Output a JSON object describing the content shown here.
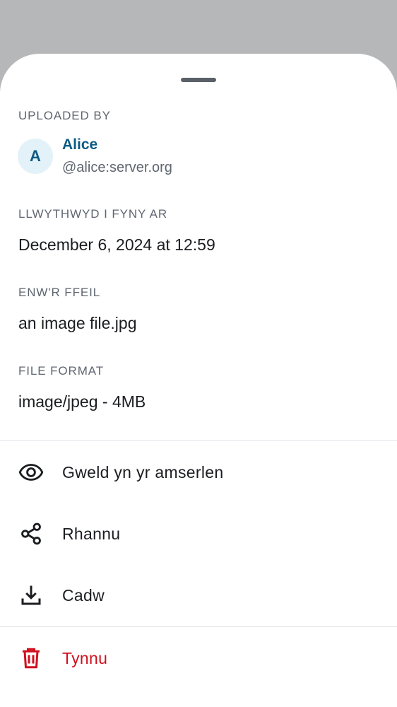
{
  "sheet": {
    "uploaded_by": {
      "label": "UPLOADED BY",
      "avatar_letter": "A",
      "name": "Alice",
      "user_id": "@alice:server.org"
    },
    "uploaded_on": {
      "label": "LLWYTHWYD I FYNY AR",
      "value": "December 6, 2024 at 12:59"
    },
    "file_name": {
      "label": "ENW'R FFEIL",
      "value": "an image file.jpg"
    },
    "file_format": {
      "label": "FILE FORMAT",
      "value": "image/jpeg - 4MB"
    },
    "actions": [
      {
        "label": "Gweld yn yr amserlen",
        "icon": "eye-icon"
      },
      {
        "label": "Rhannu",
        "icon": "share-icon"
      },
      {
        "label": "Cadw",
        "icon": "download-icon"
      },
      {
        "label": "Tynnu",
        "icon": "trash-icon"
      }
    ]
  },
  "colors": {
    "accent": "#0d5b84",
    "danger": "#d0101e",
    "scrim": "#b6b7b9"
  }
}
